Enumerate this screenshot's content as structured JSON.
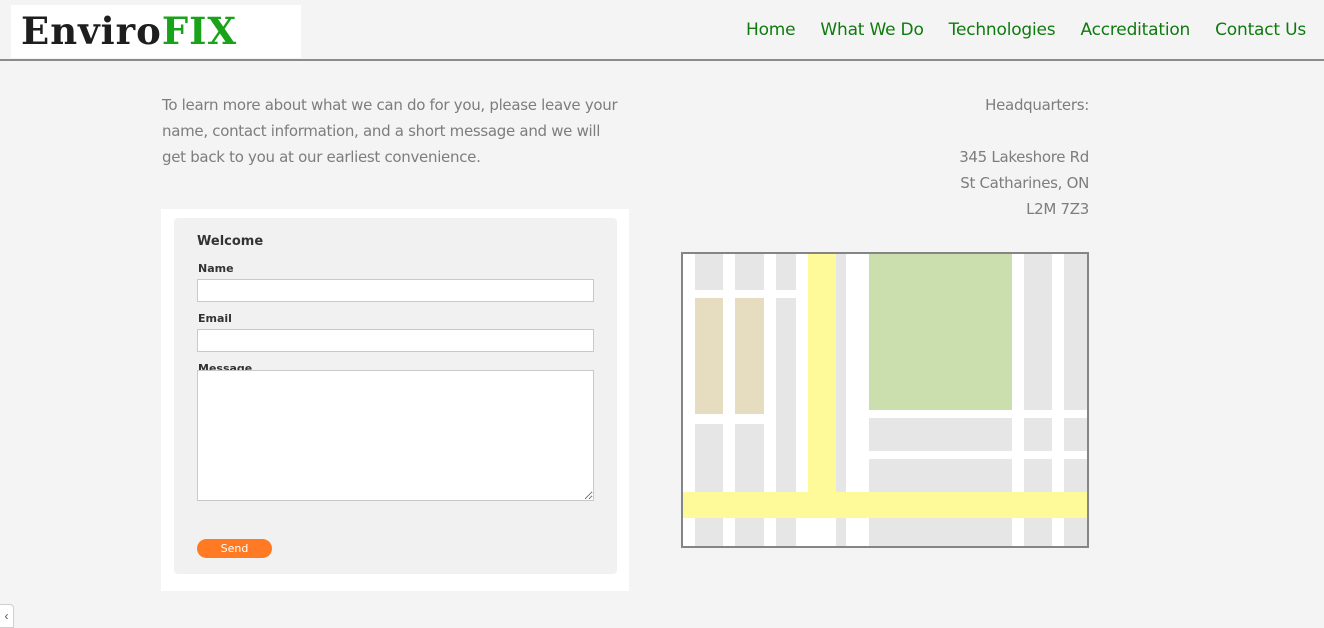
{
  "brand": {
    "part1": "Enviro",
    "part2": "FIX"
  },
  "nav": [
    {
      "label": "Home"
    },
    {
      "label": "What We Do"
    },
    {
      "label": "Technologies"
    },
    {
      "label": "Accreditation"
    },
    {
      "label": "Contact Us"
    }
  ],
  "intro": {
    "text": "To learn more about what we can do for you, please leave your name, contact information, and a short message and we will get back to you at our earliest convenience."
  },
  "headquarters": {
    "heading": "Headquarters:",
    "address_line1": "345 Lakeshore Rd",
    "address_line2": "St Catharines, ON",
    "postal_code": "L2M 7Z3"
  },
  "form": {
    "title": "Welcome",
    "name_label": "Name",
    "name_value": "",
    "email_label": "Email",
    "email_value": "",
    "message_label": "Message",
    "message_value": "",
    "send_label": "Send"
  },
  "colors": {
    "brand_dark": "#1e1e1e",
    "brand_green": "#1aa31a",
    "nav_green": "#0f7a0f",
    "send_orange": "#ff7a22",
    "map_road_yellow": "#fffa99",
    "map_park_green": "#cbdfae",
    "map_building_tan": "#e6dcc0"
  },
  "icons": {
    "edge_tab": "chevron-left-icon"
  },
  "edge_tab_glyph": "‹"
}
